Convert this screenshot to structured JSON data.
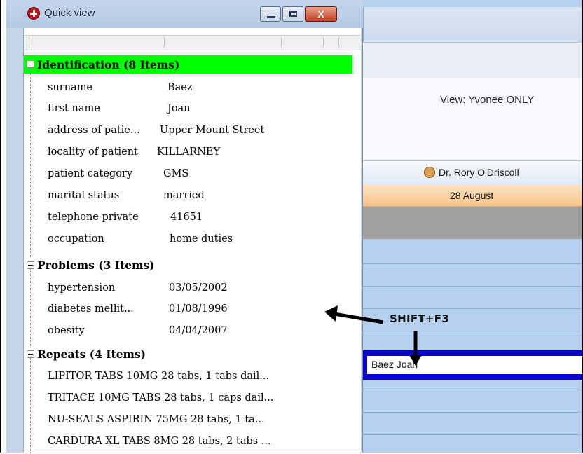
{
  "quick_view": {
    "title": "Quick view",
    "close_symbol": "X",
    "title_icon": "add-circle-icon",
    "sections": {
      "identification": {
        "heading": "Identification (8 Items)",
        "rows": [
          {
            "label": "surname",
            "value": "Baez"
          },
          {
            "label": "first name",
            "value": "Joan"
          },
          {
            "label": "address of patie...",
            "value": "Upper Mount Street"
          },
          {
            "label": "locality of patient",
            "value": "KILLARNEY"
          },
          {
            "label": "patient category",
            "value": "GMS"
          },
          {
            "label": "marital status",
            "value": "married"
          },
          {
            "label": "telephone private",
            "value": "41651"
          },
          {
            "label": "occupation",
            "value": "home duties"
          }
        ]
      },
      "problems": {
        "heading": "Problems (3 Items)",
        "rows": [
          {
            "label": "hypertension",
            "value": "03/05/2002"
          },
          {
            "label": "diabetes mellit...",
            "value": "01/08/1996"
          },
          {
            "label": "obesity",
            "value": "04/04/2007"
          }
        ]
      },
      "repeats": {
        "heading": "Repeats (4 Items)",
        "rows": [
          "LIPITOR TABS 10MG 28 tabs, 1 tabs dail...",
          "TRITACE 10MG TABS 28 tabs, 1 caps dail...",
          "NU-SEALS ASPIRIN  75MG 28 tabs, 1 ta...",
          "CARDURA XL TABS 8MG 28 tabs, 2 tabs ..."
        ]
      }
    }
  },
  "appointments": {
    "view_label": "View:  Yvonee ONLY",
    "doctor": "Dr. Rory O'Driscoll",
    "doctor_icon": "doctor-icon",
    "date": "28 August",
    "appointment_name": "Baez Joan"
  },
  "annotation": {
    "shortcut": "SHIFT+F3"
  },
  "colors": {
    "identification_highlight": "#00ff00",
    "appointment_border": "#0a00cc",
    "schedule_background": "#b6d0f0",
    "date_header": "#f7c488"
  }
}
